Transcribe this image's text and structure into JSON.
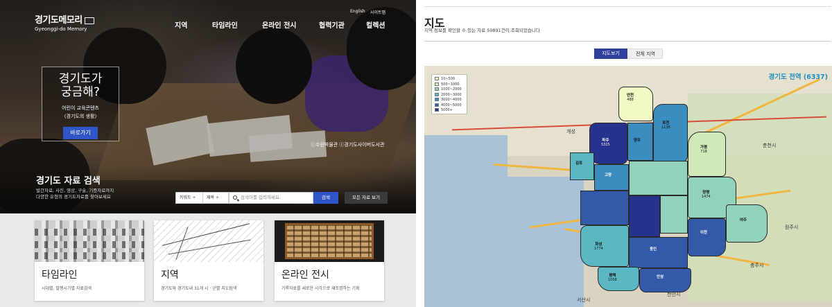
{
  "left": {
    "logo": {
      "ko": "경기도메모리",
      "en": "Gyeonggi-do Memory"
    },
    "util": [
      "English",
      "사이트맵"
    ],
    "nav": [
      "지역",
      "타임라인",
      "온라인 전시",
      "협력기관",
      "컬렉션"
    ],
    "promo": {
      "title1": "경기도가",
      "title2": "궁금해?",
      "sub1": "어린이 교육콘텐츠",
      "sub2": "〈경기도의 생활〉",
      "button": "바로가기"
    },
    "credit": "ⓒ수원박물관 ⓒ경기도사이버도서관",
    "search": {
      "title": "경기도 자료 검색",
      "sub1": "발간자료, 사진, 영상, 구술, 기증자료까지",
      "sub2": "다양한 유형의 경기도자료를 찾아보세요",
      "select1": "키워드 ÷",
      "select2": "제목 ÷",
      "placeholder": "검색어를 입력하세요.",
      "button": "검색",
      "all_button": "모든 자료 보기"
    },
    "cards": [
      {
        "title": "타임라인",
        "desc": "시대별, 발행시기별 자료검색"
      },
      {
        "title": "지역",
        "desc": "경기도와 경기도내 31개 시 · 군별 지도탐색"
      },
      {
        "title": "온라인 전시",
        "desc": "기록자료를 새로운 시각으로 재조명하는 기획"
      }
    ]
  },
  "right": {
    "title": "지도",
    "subtitle": "지역 정보를 확인할 수 있는 자료 50891건이 조회되었습니다",
    "tabs": [
      "지도보기",
      "전체 지역"
    ],
    "map_label": "경기도 전역 (6337)",
    "legend": [
      {
        "label": "10~500",
        "color": "#f3f9c5"
      },
      {
        "label": "500~1000",
        "color": "#cfeab8"
      },
      {
        "label": "1000~2000",
        "color": "#93d2ba"
      },
      {
        "label": "2000~3000",
        "color": "#59b8c4"
      },
      {
        "label": "3000~4000",
        "color": "#3a8dbe"
      },
      {
        "label": "4000~5000",
        "color": "#325aa8"
      },
      {
        "label": "5000+",
        "color": "#26338c"
      }
    ],
    "regions": [
      {
        "name": "연천",
        "count": "488"
      },
      {
        "name": "포천",
        "count": "1138"
      },
      {
        "name": "파주",
        "count": "5325"
      },
      {
        "name": "양주",
        "count": ""
      },
      {
        "name": "가평",
        "count": "718"
      },
      {
        "name": "김포",
        "count": ""
      },
      {
        "name": "고양",
        "count": ""
      },
      {
        "name": "양평",
        "count": "1474"
      },
      {
        "name": "화성",
        "count": "1774"
      },
      {
        "name": "평택",
        "count": "1058"
      },
      {
        "name": "안성",
        "count": ""
      },
      {
        "name": "이천",
        "count": ""
      },
      {
        "name": "용인",
        "count": ""
      },
      {
        "name": "여주",
        "count": ""
      }
    ],
    "cities": [
      "개성",
      "춘천시",
      "원주시",
      "충주시",
      "천안시",
      "서산시"
    ]
  }
}
